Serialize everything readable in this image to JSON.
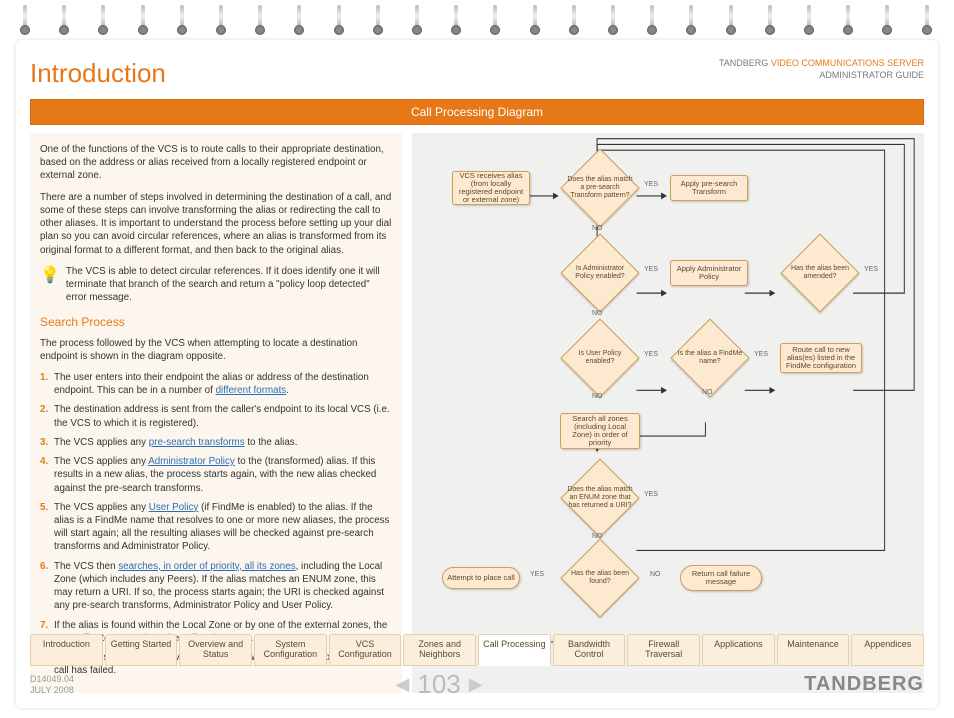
{
  "header": {
    "title": "Introduction",
    "brand_prefix": "TANDBERG ",
    "brand_accent": "VIDEO COMMUNICATIONS SERVER",
    "brand_line2": "ADMINISTRATOR GUIDE",
    "bar": "Call Processing Diagram"
  },
  "body": {
    "p1": "One of the functions of the VCS is to route calls to their appropriate destination, based on the address or alias received from a locally registered endpoint or external zone.",
    "p2": "There are a number of steps involved in determining the destination of a call, and some of these steps can involve transforming the alias or redirecting the call to other aliases.  It is important to understand the process before setting up your dial plan so you can avoid circular references, where an alias is transformed from its original format to a different format, and then back to the original alias.",
    "bulb": "The VCS is able to detect circular references.  If it does identify one it will terminate that branch of the search and return a \"policy loop detected\" error message.",
    "subhead": "Search Process",
    "p3": "The process followed by the VCS when attempting to locate a destination endpoint is shown in the diagram opposite.",
    "steps": [
      {
        "pre": "The user enters into their endpoint the alias or address of the destination endpoint.  This can be in a number of ",
        "link": "different formats",
        "post": "."
      },
      {
        "pre": "The destination address is sent from the caller's endpoint to its local VCS (i.e. the VCS to which it is registered).",
        "link": "",
        "post": ""
      },
      {
        "pre": "The VCS applies any ",
        "link": "pre-search transforms",
        "post": " to the alias."
      },
      {
        "pre": "The VCS applies any ",
        "link": "Administrator Policy",
        "post": " to the (transformed) alias.  If this results in a new alias, the process starts again, with the new alias checked against the pre-search transforms."
      },
      {
        "pre": "The VCS applies any ",
        "link": "User Policy",
        "post": " (if FindMe is enabled) to the alias.  If the alias is a FindMe name that resolves to one or more new aliases, the process will start again; all the resulting aliases will be checked against pre-search transforms and Administrator Policy."
      },
      {
        "pre": "The VCS then ",
        "link": "searches, in order of priority, all its zones",
        "post": ", including the Local Zone (which includes any Peers). If the alias matches an ENUM zone, this may return a URI. If so, the process starts again; the URI is checked against any pre-search transforms, Administrator Policy and User Policy."
      },
      {
        "pre": "If the alias is found within the Local Zone or by one of the external zones, the VCS will attempt to place the call to that zone.",
        "link": "",
        "post": ""
      },
      {
        "pre": "If the alias is not found, the VCS will respond with a message to say that the call has failed.",
        "link": "",
        "post": ""
      }
    ]
  },
  "flow": {
    "n1": "VCS receives alias (from locally registered endpoint or external zone)",
    "d1": "Does the alias match a pre-search Transform pattern?",
    "n2": "Apply pre-search Transform",
    "d2": "Is Administrator Policy enabled?",
    "n3": "Apply Administrator Policy",
    "d3": "Has the alias been amended?",
    "d4": "Is User Policy enabled?",
    "d5": "Is the alias a FindMe name?",
    "n4": "Route call to new alias(es) listed in the FindMe configuration",
    "n5": "Search all zones (including Local Zone) in order of priority",
    "d6": "Does the alias match an ENUM zone that has returned a URI?",
    "d7": "Has the alias been found?",
    "n6": "Attempt to place call",
    "n7": "Return call failure message",
    "yes": "YES",
    "no": "NO"
  },
  "tabs": [
    "Introduction",
    "Getting Started",
    "Overview and Status",
    "System Configuration",
    "VCS Configuration",
    "Zones and Neighbors",
    "Call Processing",
    "Bandwidth Control",
    "Firewall Traversal",
    "Applications",
    "Maintenance",
    "Appendices"
  ],
  "footer": {
    "doc": "D14049.04",
    "date": "JULY 2008",
    "page": "103",
    "logo": "TANDBERG"
  }
}
